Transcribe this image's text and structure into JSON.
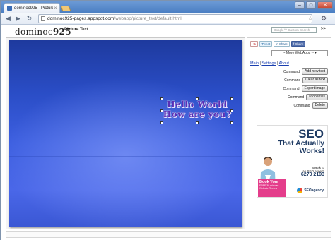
{
  "browser": {
    "tab_title": "dominoc925 - Picture Text",
    "tab_close": "x",
    "url_host": "dominoc925-pages.appspot.com",
    "url_path": "/webapp/picture_text/default.html",
    "window_buttons": {
      "minimize": "–",
      "maximize": "□",
      "close": "✕"
    },
    "nav": {
      "back": "◀",
      "forward": "▶",
      "reload": "↻"
    },
    "star": "☆",
    "menu": "⚙"
  },
  "header": {
    "logo_text": "dominoc",
    "logo_num": "925",
    "title": "Picture Text",
    "search_placeholder": "Google™ Custom Search",
    "search_button": ">>"
  },
  "editor": {
    "overlay_lines": [
      "Hello World",
      "How are you?"
    ],
    "overlay_color": "#5a2fb5"
  },
  "sidebar": {
    "share": {
      "plus": "+1",
      "tweet": "Tweet",
      "linkedin": "in Share",
      "facebook": "f Share"
    },
    "webapps_select": "-- More WebApps --",
    "nav_links": [
      "Main",
      "Settings",
      "About"
    ],
    "commands": [
      {
        "label": "Command",
        "button": "Add new text"
      },
      {
        "label": "Command",
        "button": "Clear all text"
      },
      {
        "label": "Command",
        "button": "Export image"
      },
      {
        "label": "Command",
        "button": "Properties"
      },
      {
        "label": "Command",
        "button": "Delete"
      }
    ]
  },
  "ad": {
    "seo": "SEO",
    "headline": "That Actually Works!",
    "speak_line1": "Speak to",
    "speak_line2": "an SEO expert:",
    "phone": "6270 2193",
    "book_title": "Book Your",
    "book_line1": "FREE 30 minutes",
    "book_line2": "Website Review",
    "brand": "SEOagency",
    "colors": {
      "navy": "#1f3b63",
      "pink": "#e43d8b"
    }
  }
}
